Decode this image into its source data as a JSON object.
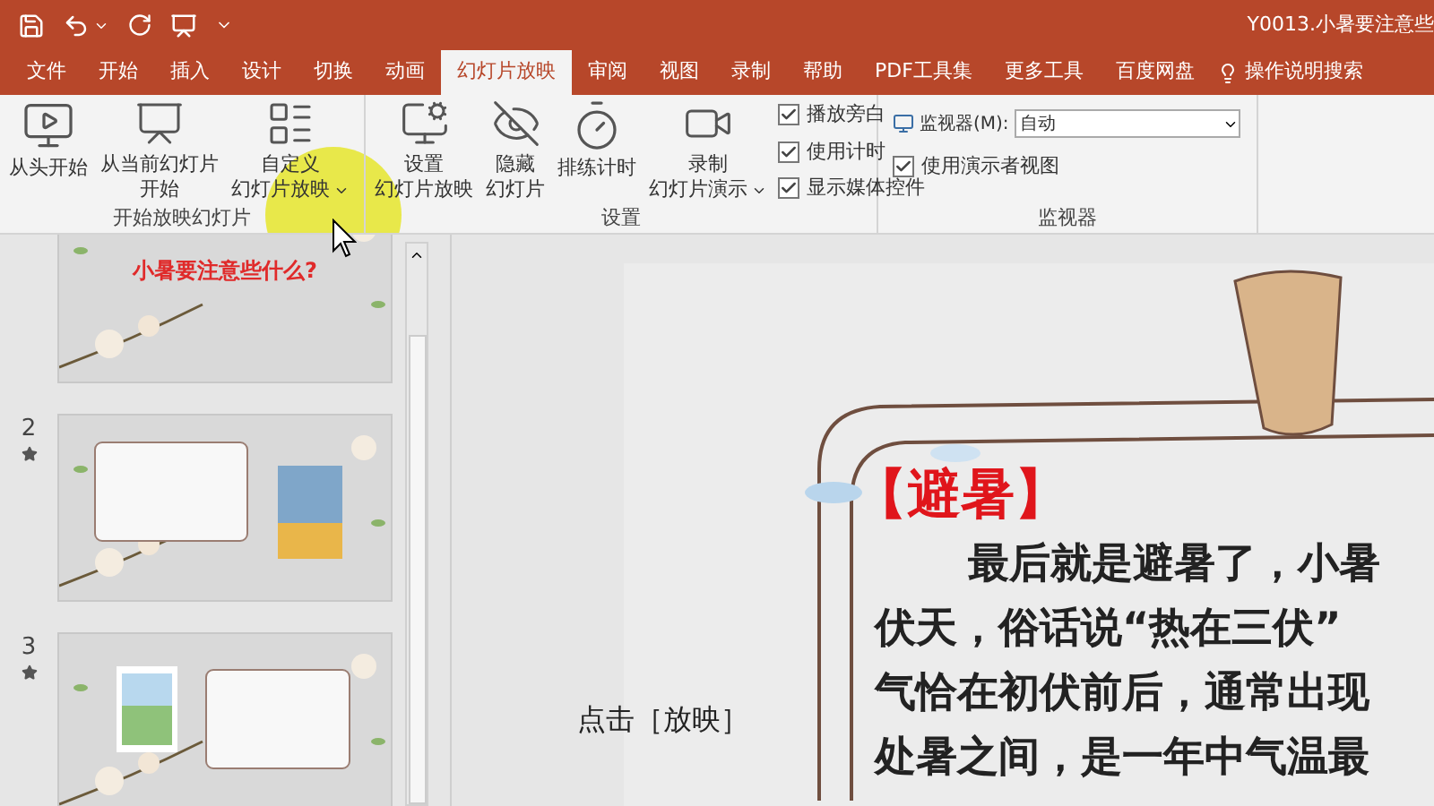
{
  "window": {
    "title": "Y0013.小暑要注意些"
  },
  "tabs": [
    {
      "label": "文件",
      "selected": false
    },
    {
      "label": "开始",
      "selected": false
    },
    {
      "label": "插入",
      "selected": false
    },
    {
      "label": "设计",
      "selected": false
    },
    {
      "label": "切换",
      "selected": false
    },
    {
      "label": "动画",
      "selected": false
    },
    {
      "label": "幻灯片放映",
      "selected": true
    },
    {
      "label": "审阅",
      "selected": false
    },
    {
      "label": "视图",
      "selected": false
    },
    {
      "label": "录制",
      "selected": false
    },
    {
      "label": "帮助",
      "selected": false
    },
    {
      "label": "PDF工具集",
      "selected": false
    },
    {
      "label": "更多工具",
      "selected": false
    },
    {
      "label": "百度网盘",
      "selected": false
    }
  ],
  "search": {
    "placeholder": "操作说明搜索"
  },
  "ribbon": {
    "groups": [
      {
        "label": "开始放映幻灯片",
        "buttons": [
          {
            "lines": [
              "从头开始"
            ],
            "dropdown": false
          },
          {
            "lines": [
              "从当前幻灯片",
              "开始"
            ],
            "dropdown": false
          },
          {
            "lines": [
              "自定义",
              "幻灯片放映"
            ],
            "dropdown": true
          }
        ]
      },
      {
        "label": "设置",
        "buttons": [
          {
            "lines": [
              "设置",
              "幻灯片放映"
            ],
            "dropdown": false
          },
          {
            "lines": [
              "隐藏",
              "幻灯片"
            ],
            "dropdown": false
          },
          {
            "lines": [
              "排练计时"
            ],
            "dropdown": false
          },
          {
            "lines": [
              "录制",
              "幻灯片演示"
            ],
            "dropdown": true
          }
        ],
        "checkboxes": [
          {
            "label": "播放旁白",
            "checked": true
          },
          {
            "label": "使用计时",
            "checked": true
          },
          {
            "label": "显示媒体控件",
            "checked": true
          }
        ]
      },
      {
        "label": "监视器",
        "monitor": {
          "label": "监视器(M):",
          "value": "自动"
        },
        "checkboxes": [
          {
            "label": "使用演示者视图",
            "checked": true
          }
        ]
      }
    ]
  },
  "slides": [
    {
      "title": "小暑要注意些什么?"
    },
    {
      "number": "2",
      "animated": true
    },
    {
      "number": "3",
      "animated": true
    }
  ],
  "slide": {
    "heading": "【避暑】",
    "lines": [
      "最后就是避暑了，小暑",
      "伏天，俗话说“热在三伏”",
      "气恰在初伏前后，通常出现",
      "处暑之间，是一年中气温最"
    ]
  },
  "caption": "点击［放映］"
}
